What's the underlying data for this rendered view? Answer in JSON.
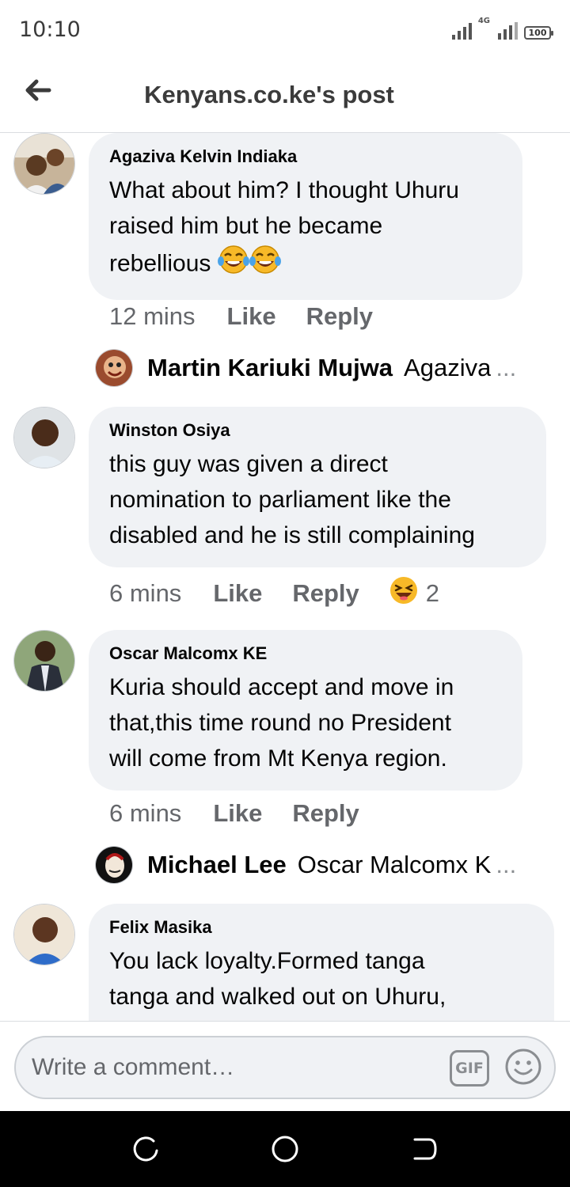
{
  "status": {
    "time": "10:10",
    "network": "4G",
    "battery": "100"
  },
  "header": {
    "title": "Kenyans.co.ke's post"
  },
  "comments": [
    {
      "author": "Agaziva Kelvin Indiaka",
      "lines": [
        "What about him? I thought Uhuru",
        "raised him but he became",
        "rebellious"
      ],
      "emoji_count": 2,
      "time": "12 mins",
      "like": "Like",
      "reply": "Reply",
      "reply_preview": {
        "name": "Martin Kariuki Mujwa",
        "text": "Agaziva",
        "ellipsis": "..."
      }
    },
    {
      "author": "Winston Osiya",
      "lines": [
        "this guy was given a direct",
        "nomination to parliament like the",
        "disabled and he is still complaining"
      ],
      "time": "6 mins",
      "like": "Like",
      "reply": "Reply",
      "reaction": {
        "icon": "laughing-reaction-icon",
        "count": "2"
      }
    },
    {
      "author": "Oscar Malcomx KE",
      "lines": [
        "Kuria should accept and move in",
        "that,this time round no President",
        "will come from Mt Kenya region."
      ],
      "time": "6 mins",
      "like": "Like",
      "reply": "Reply",
      "reply_preview": {
        "name": "Michael Lee",
        "text": "Oscar Malcomx K",
        "ellipsis": "..."
      }
    },
    {
      "author": "Felix Masika",
      "lines": [
        "You lack loyalty.Formed tanga",
        "tanga and walked out on Uhuru,"
      ]
    }
  ],
  "composer": {
    "placeholder": "Write a comment…",
    "gif_label": "GIF"
  },
  "colors": {
    "bubble": "#f0f2f5",
    "meta_text": "#65676b",
    "reaction": "#f7b928"
  }
}
